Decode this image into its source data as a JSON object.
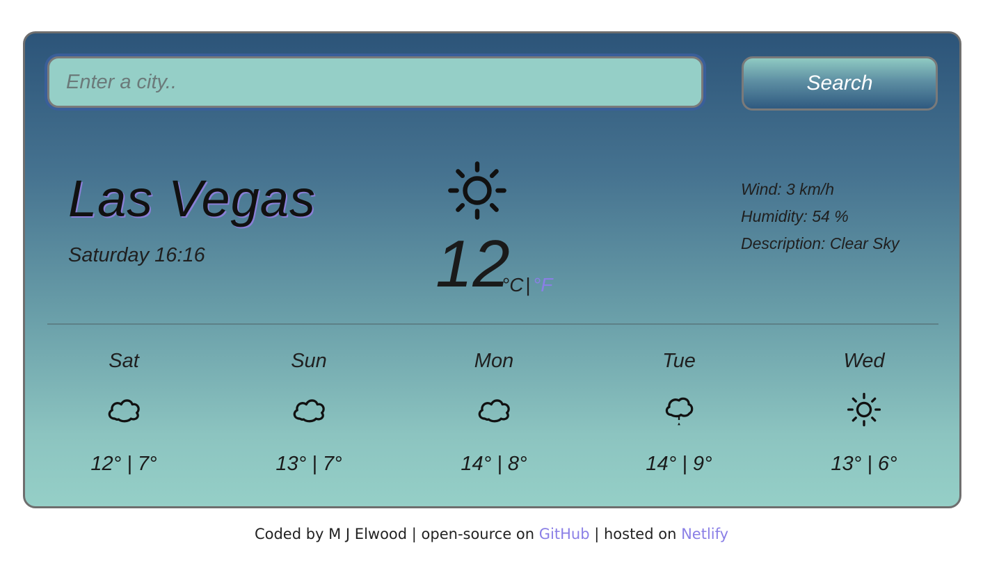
{
  "search": {
    "placeholder": "Enter a city..",
    "value": "",
    "button_label": "Search"
  },
  "current": {
    "city": "Las Vegas",
    "datetime": "Saturday 16:16",
    "icon": "sun-icon",
    "temperature": "12",
    "unit_celsius": "°C",
    "unit_separator": "|",
    "unit_fahrenheit": "°F",
    "wind": "Wind: 3 km/h",
    "humidity": "Humidity: 54 %",
    "description": "Description: Clear Sky"
  },
  "forecast": [
    {
      "day": "Sat",
      "icon": "cloud-icon",
      "temps": "12° | 7°"
    },
    {
      "day": "Sun",
      "icon": "cloud-icon",
      "temps": "13° | 7°"
    },
    {
      "day": "Mon",
      "icon": "cloud-icon",
      "temps": "14° | 8°"
    },
    {
      "day": "Tue",
      "icon": "cloud-rain-icon",
      "temps": "14° | 9°"
    },
    {
      "day": "Wed",
      "icon": "sun-icon",
      "temps": "13° | 6°"
    }
  ],
  "footer": {
    "prefix": "Coded by M J Elwood | open-source on ",
    "github_label": "GitHub",
    "middle": " | hosted on ",
    "netlify_label": "Netlify"
  },
  "colors": {
    "accent_link": "#8a7fe6",
    "card_top": "#2c5479",
    "card_bottom": "#95cfc7",
    "border": "#6e6e6e"
  }
}
